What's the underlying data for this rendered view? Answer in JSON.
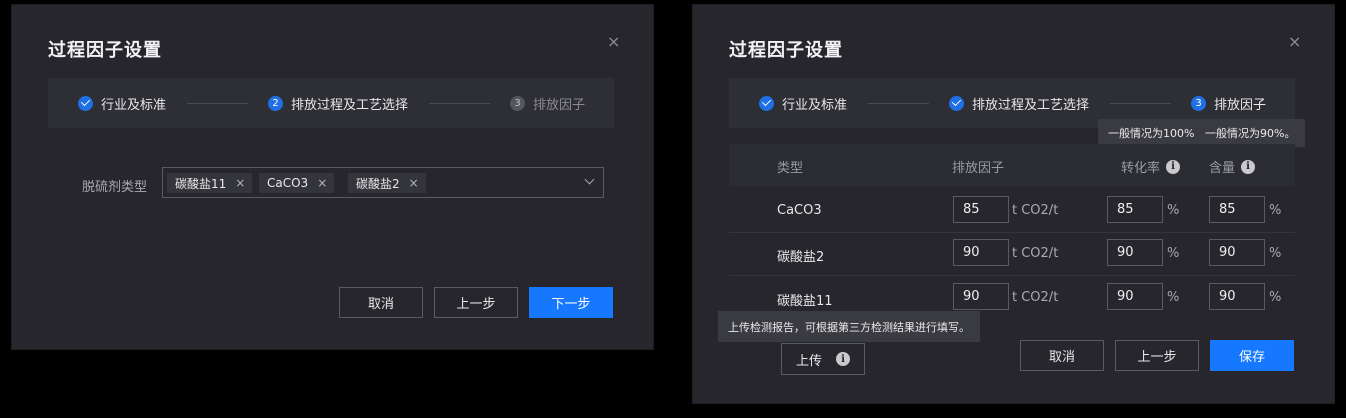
{
  "dialog1": {
    "title": "过程因子设置",
    "steps": [
      {
        "label": "行业及标准",
        "state": "done"
      },
      {
        "label": "排放过程及工艺选择",
        "num": "2",
        "state": "active"
      },
      {
        "label": "排放因子",
        "num": "3",
        "state": "pending"
      }
    ],
    "field_label": "脱硫剂类型",
    "tags": [
      "碳酸盐11",
      "CaCO3",
      "碳酸盐2"
    ],
    "buttons": {
      "cancel": "取消",
      "prev": "上一步",
      "next": "下一步"
    }
  },
  "dialog2": {
    "title": "过程因子设置",
    "steps": [
      {
        "label": "行业及标准",
        "state": "done"
      },
      {
        "label": "排放过程及工艺选择",
        "state": "done"
      },
      {
        "label": "排放因子",
        "num": "3",
        "state": "active"
      }
    ],
    "columns": {
      "type": "类型",
      "factor": "排放因子",
      "conversion": "转化率",
      "content": "含量"
    },
    "tooltips": {
      "conversion": "一般情况为100%",
      "content": "一般情况为90%。",
      "upload": "上传检测报告，可根据第三方检测结果进行填写。"
    },
    "rows": [
      {
        "type": "CaCO3",
        "factor": "85",
        "factor_unit": "t CO2/t",
        "conversion": "85",
        "conversion_unit": "%",
        "content": "85",
        "content_unit": "%"
      },
      {
        "type": "碳酸盐2",
        "factor": "90",
        "factor_unit": "t CO2/t",
        "conversion": "90",
        "conversion_unit": "%",
        "content": "90",
        "content_unit": "%"
      },
      {
        "type": "碳酸盐11",
        "factor": "90",
        "factor_unit": "t CO2/t",
        "conversion": "90",
        "conversion_unit": "%",
        "content": "90",
        "content_unit": "%"
      }
    ],
    "upload_label": "上传",
    "buttons": {
      "cancel": "取消",
      "prev": "上一步",
      "save": "保存"
    }
  },
  "icons": {
    "close": "×",
    "info": "i"
  },
  "colors": {
    "primary": "#1677ff",
    "dialog_bg": "#26262c",
    "step_bar_bg": "#2e2e35"
  }
}
